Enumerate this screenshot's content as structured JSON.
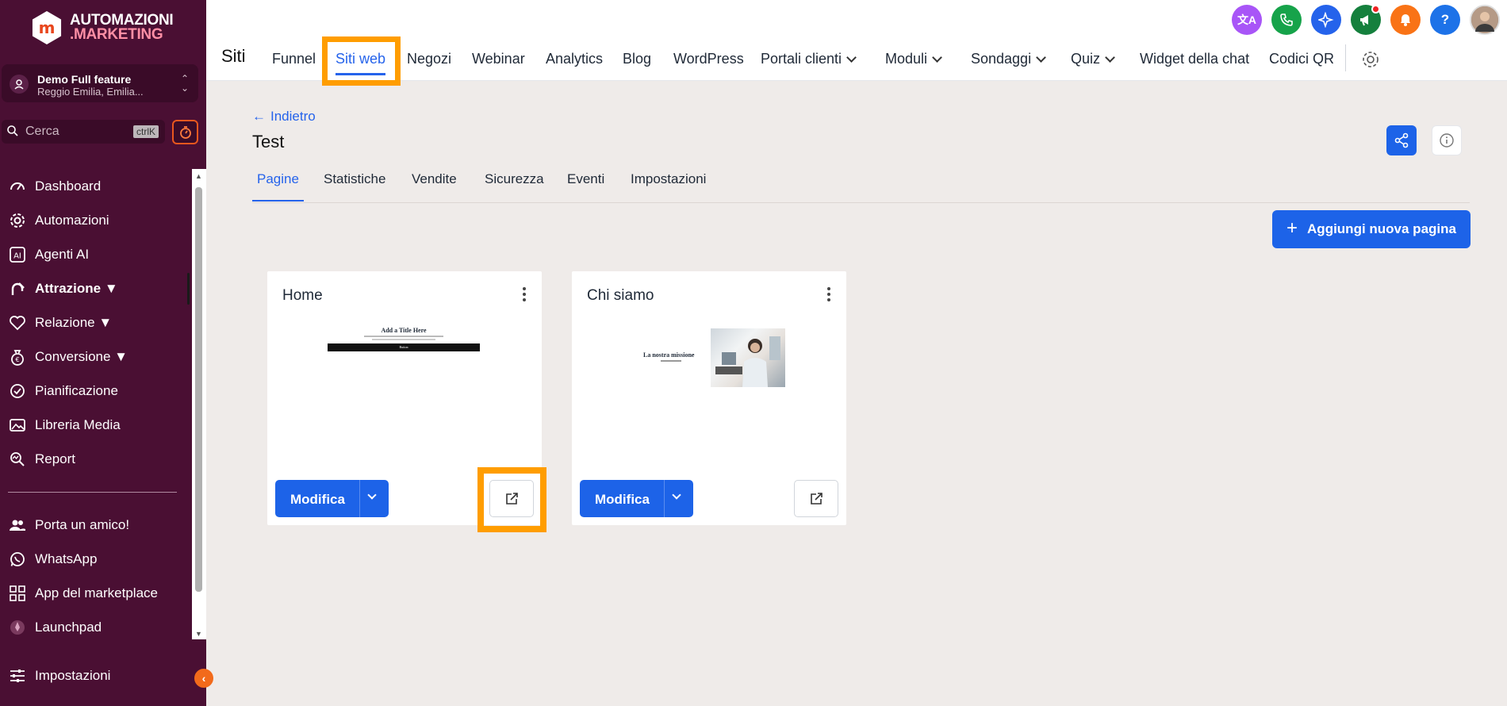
{
  "brand": {
    "line1": "AUTOMAZIONI",
    "line2": ".MARKETING",
    "mark": "m"
  },
  "account": {
    "name": "Demo Full feature",
    "location": "Reggio Emilia, Emilia..."
  },
  "search": {
    "placeholder": "Cerca",
    "shortcut": "ctrlK"
  },
  "sidebar": {
    "items": [
      {
        "label": "Dashboard",
        "icon": "gauge-icon"
      },
      {
        "label": "Automazioni",
        "icon": "gear-icon"
      },
      {
        "label": "Agenti AI",
        "icon": "ai-icon"
      },
      {
        "label": "Attrazione ▼",
        "icon": "magnet-icon"
      },
      {
        "label": "Relazione ▼",
        "icon": "heart-icon"
      },
      {
        "label": "Conversione ▼",
        "icon": "money-bag-icon"
      },
      {
        "label": "Pianificazione",
        "icon": "check-circle-icon"
      },
      {
        "label": "Libreria Media",
        "icon": "image-icon"
      },
      {
        "label": "Report",
        "icon": "report-icon"
      },
      {
        "label": "Porta un amico!",
        "icon": "users-icon"
      },
      {
        "label": "WhatsApp",
        "icon": "whatsapp-icon"
      },
      {
        "label": "App del marketplace",
        "icon": "grid-icon"
      },
      {
        "label": "Launchpad",
        "icon": "rocket-icon"
      }
    ],
    "settings": "Impostazioni"
  },
  "topbar": {
    "section": "Siti",
    "tabs": [
      "Funnel",
      "Siti web",
      "Negozi",
      "Webinar",
      "Analytics",
      "Blog",
      "WordPress",
      "Portali clienti",
      "Moduli",
      "Sondaggi",
      "Quiz",
      "Widget della chat",
      "Codici QR"
    ],
    "active_tab": "Siti web",
    "help": "?"
  },
  "header": {
    "back": "Indietro",
    "title": "Test"
  },
  "subtabs": [
    "Pagine",
    "Statistiche",
    "Vendite",
    "Sicurezza",
    "Eventi",
    "Impostazioni"
  ],
  "add_page": "Aggiungi nuova pagina",
  "pages": [
    {
      "title": "Home",
      "edit": "Modifica",
      "preview": {
        "heading": "Add a Title Here",
        "button": "Button"
      }
    },
    {
      "title": "Chi siamo",
      "edit": "Modifica",
      "preview": {
        "heading": "La nostra missione"
      }
    }
  ],
  "colors": {
    "sidebar": "#4a0f33",
    "primary": "#1d63e8",
    "highlight": "#ff9d00"
  }
}
